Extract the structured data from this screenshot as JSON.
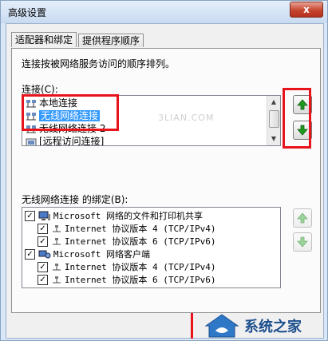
{
  "window": {
    "title": "高级设置",
    "close_glyph": "x"
  },
  "tabs": [
    {
      "label": "适配器和绑定",
      "active": true
    },
    {
      "label": "提供程序顺序",
      "active": false
    }
  ],
  "panel": {
    "description": "连接按被网络服务访问的顺序排列。",
    "connections_label": "连接(C):",
    "connections": [
      {
        "label": "本地连接",
        "selected": false
      },
      {
        "label": "无线网络连接",
        "selected": true
      },
      {
        "label": "无线网络连接 2",
        "selected": false
      },
      {
        "label": "[远程访问连接]",
        "selected": false
      }
    ],
    "bindings_label": "无线网络连接 的绑定(B):",
    "bindings": [
      {
        "label": "Microsoft 网络的文件和打印机共享",
        "checked": true,
        "level": 0,
        "icon": "computer-icon"
      },
      {
        "label": "Internet 协议版本 4 (TCP/IPv4)",
        "checked": true,
        "level": 1,
        "icon": "protocol-icon"
      },
      {
        "label": "Internet 协议版本 6 (TCP/IPv6)",
        "checked": true,
        "level": 1,
        "icon": "protocol-icon"
      },
      {
        "label": "Microsoft 网络客户端",
        "checked": true,
        "level": 0,
        "icon": "network-client-icon"
      },
      {
        "label": "Internet 协议版本 4 (TCP/IPv4)",
        "checked": true,
        "level": 1,
        "icon": "protocol-icon"
      },
      {
        "label": "Internet 协议版本 6 (TCP/IPv6)",
        "checked": true,
        "level": 1,
        "icon": "protocol-icon"
      }
    ]
  },
  "watermark": {
    "text": "3LIAN.COM",
    "site_name": "系统之家"
  },
  "colors": {
    "highlight": "#e8141b",
    "selection": "#3399ff",
    "arrow_green": "#1f9a1f"
  }
}
